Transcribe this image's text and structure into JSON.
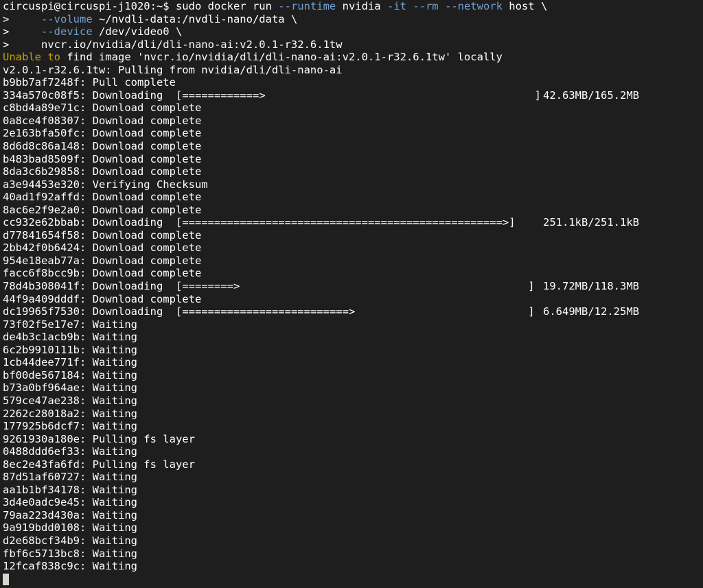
{
  "terminal": {
    "prompt": "circuspi@circuspi-j1020:~$",
    "command": " sudo docker run ",
    "cmd_flag_runtime": "--runtime",
    "cmd_runtime_val": " nvidia ",
    "cmd_flag_it": "-it",
    "cmd_flag_rm": "--rm",
    "cmd_flag_network": "--network",
    "cmd_network_val": " host \\",
    "cont1_prefix": ">     ",
    "cont1_flag": "--volume",
    "cont1_val": " ~/nvdli-data:/nvdli-nano/data \\",
    "cont2_prefix": ">     ",
    "cont2_flag": "--device",
    "cont2_val": " /dev/video0 \\",
    "cont3": ">     nvcr.io/nvidia/dli/dli-nano-ai:v2.0.1-r32.6.1tw",
    "unable_prefix": "Unable to",
    "unable_rest": " find image 'nvcr.io/nvidia/dli/dli-nano-ai:v2.0.1-r32.6.1tw' locally",
    "pulling_from": "v2.0.1-r32.6.1tw: Pulling from nvidia/dli/dli-nano-ai"
  },
  "layers": [
    {
      "id": "b9bb7af7248f",
      "status": "Pull complete"
    },
    {
      "id": "334a570c08f5",
      "status": "Downloading",
      "bar": "[============>                                          ]",
      "size": "42.63MB/165.2MB"
    },
    {
      "id": "c8bd4a89e71c",
      "status": "Download complete"
    },
    {
      "id": "0a8ce4f08307",
      "status": "Download complete"
    },
    {
      "id": "2e163bfa50fc",
      "status": "Download complete"
    },
    {
      "id": "8d6d8c86a148",
      "status": "Download complete"
    },
    {
      "id": "b483bad8509f",
      "status": "Download complete"
    },
    {
      "id": "8da3c6b29858",
      "status": "Download complete"
    },
    {
      "id": "a3e94453e320",
      "status": "Verifying Checksum"
    },
    {
      "id": "40ad1f92affd",
      "status": "Download complete"
    },
    {
      "id": "8ac6e2f9e2a0",
      "status": "Download complete"
    },
    {
      "id": "cc932e62bbab",
      "status": "Downloading",
      "bar": "[==================================================>]",
      "size": "251.1kB/251.1kB"
    },
    {
      "id": "d77841654f58",
      "status": "Download complete"
    },
    {
      "id": "2bb42f0b6424",
      "status": "Download complete"
    },
    {
      "id": "954e18eab77a",
      "status": "Download complete"
    },
    {
      "id": "facc6f8bcc9b",
      "status": "Download complete"
    },
    {
      "id": "78d4b308041f",
      "status": "Downloading",
      "bar": "[========>                                             ]",
      "size": "19.72MB/118.3MB"
    },
    {
      "id": "44f9a409dddf",
      "status": "Download complete"
    },
    {
      "id": "dc19965f7530",
      "status": "Downloading",
      "bar": "[==========================>                           ]",
      "size": "6.649MB/12.25MB"
    },
    {
      "id": "73f02f5e17e7",
      "status": "Waiting"
    },
    {
      "id": "de4b3c1acb9b",
      "status": "Waiting"
    },
    {
      "id": "6c2b9910111b",
      "status": "Waiting"
    },
    {
      "id": "1cb44dee771f",
      "status": "Waiting"
    },
    {
      "id": "bf00de567184",
      "status": "Waiting"
    },
    {
      "id": "b73a0bf964ae",
      "status": "Waiting"
    },
    {
      "id": "579ce47ae238",
      "status": "Waiting"
    },
    {
      "id": "2262c28018a2",
      "status": "Waiting"
    },
    {
      "id": "177925b6dcf7",
      "status": "Waiting"
    },
    {
      "id": "9261930a180e",
      "status": "Pulling fs layer"
    },
    {
      "id": "0488ddd6ef33",
      "status": "Waiting"
    },
    {
      "id": "8ec2e43fa6fd",
      "status": "Pulling fs layer"
    },
    {
      "id": "87d51af60727",
      "status": "Waiting"
    },
    {
      "id": "aa1b1bf34178",
      "status": "Waiting"
    },
    {
      "id": "3d4e0adc9e45",
      "status": "Waiting"
    },
    {
      "id": "79aa223d430a",
      "status": "Waiting"
    },
    {
      "id": "9a919bdd0108",
      "status": "Waiting"
    },
    {
      "id": "d2e68bcf34b9",
      "status": "Waiting"
    },
    {
      "id": "fbf6c5713bc8",
      "status": "Waiting"
    },
    {
      "id": "12fcaf838c9c",
      "status": "Waiting"
    }
  ],
  "colors": {
    "background": "#1e1e1e",
    "foreground": "#ffffff",
    "flag": "#729fcf",
    "warning": "#c4a000",
    "cursor": "#d3d7cf"
  }
}
